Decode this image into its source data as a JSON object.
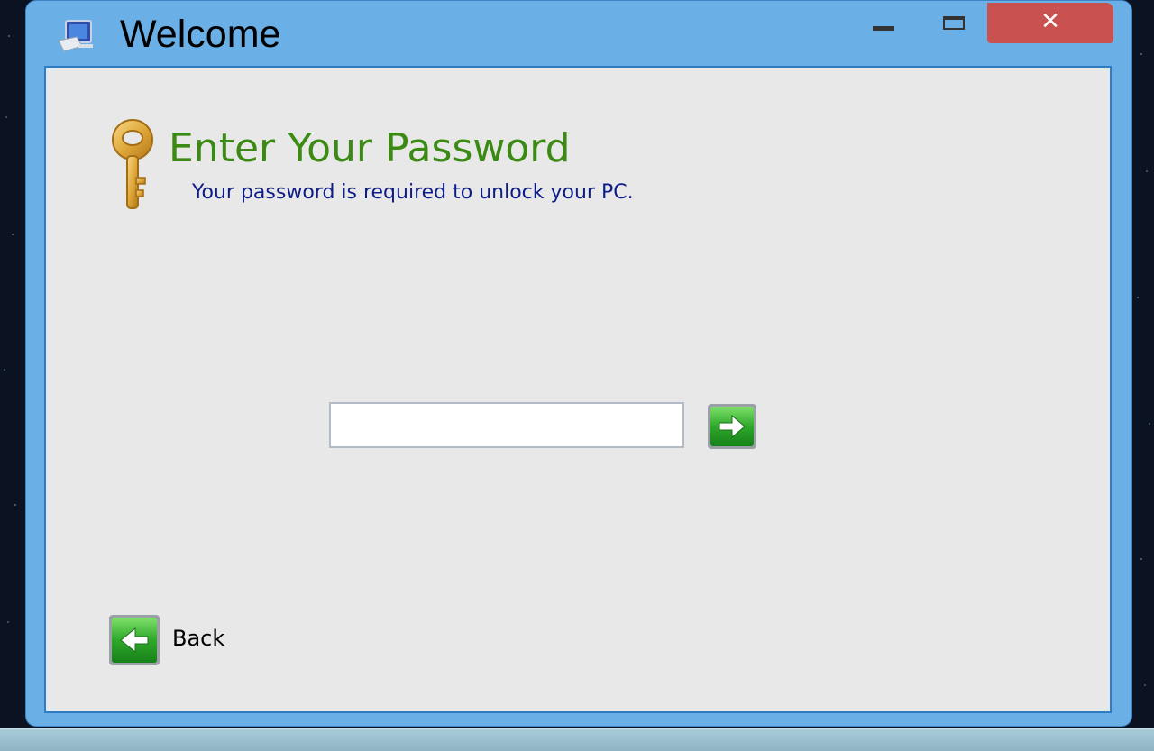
{
  "window": {
    "title": "Welcome",
    "close_glyph": "✕",
    "icons": {
      "app": "computer-icon",
      "minimize": "minimize-icon",
      "maximize": "maximize-icon",
      "close": "close-icon"
    }
  },
  "content": {
    "heading": "Enter Your Password",
    "subheading": "Your password is required to unlock your PC.",
    "key_icon": "key-icon",
    "password": {
      "value": "",
      "placeholder": ""
    },
    "submit_icon": "arrow-right-icon",
    "back": {
      "label": "Back",
      "icon": "arrow-left-icon"
    }
  },
  "colors": {
    "window_frame": "#6aafe6",
    "close_button": "#c9514f",
    "heading": "#3a8a13",
    "subheading": "#0d1c8a",
    "content_bg": "#e8e8e8",
    "button_green": "#2ea82a"
  }
}
